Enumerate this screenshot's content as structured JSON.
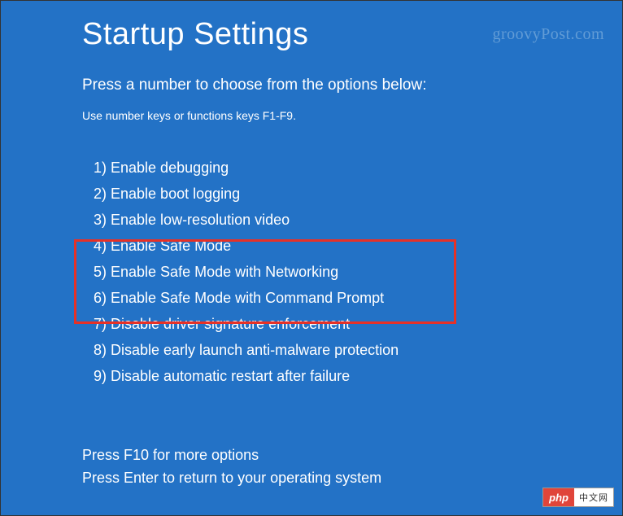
{
  "title": "Startup Settings",
  "instruction": "Press a number to choose from the options below:",
  "hint": "Use number keys or functions keys F1-F9.",
  "options": [
    "1) Enable debugging",
    "2) Enable boot logging",
    "3) Enable low-resolution video",
    "4) Enable Safe Mode",
    "5) Enable Safe Mode with Networking",
    "6) Enable Safe Mode with Command Prompt",
    "7) Disable driver signature enforcement",
    "8) Disable early launch anti-malware protection",
    "9) Disable automatic restart after failure"
  ],
  "footer": {
    "line1": "Press F10 for more options",
    "line2": "Press Enter to return to your operating system"
  },
  "watermark": "groovyPost.com",
  "badge": {
    "left": "php",
    "right": "中文网"
  }
}
